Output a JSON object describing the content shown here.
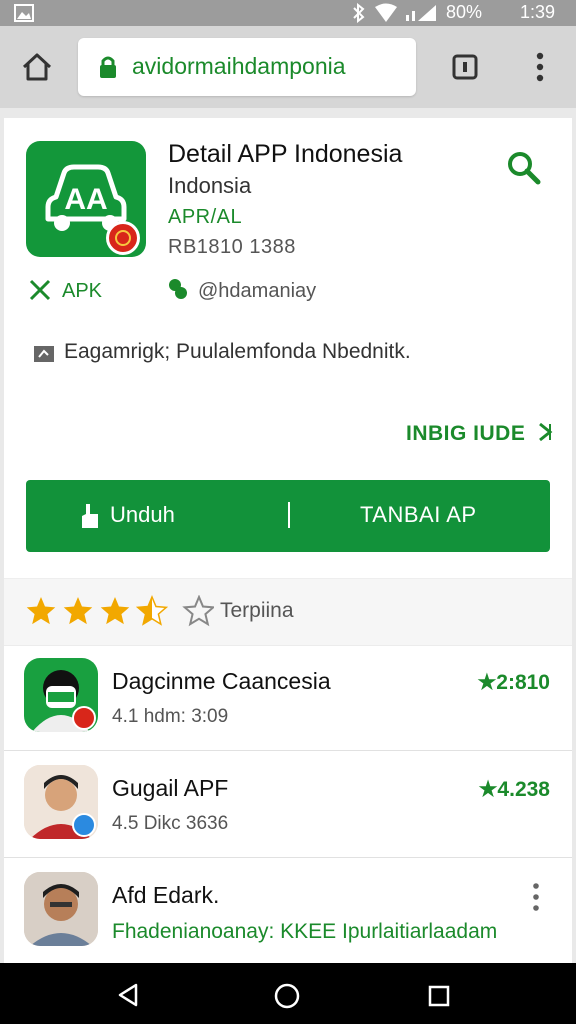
{
  "status_bar": {
    "battery": "80%",
    "time": "1:39"
  },
  "browser": {
    "url": "avidormaihdamponia"
  },
  "app": {
    "title": "Detail APP Indonesia",
    "subtitle": "Indonsia",
    "tag": "APR/AL",
    "version": "RB1810 1388",
    "meta_left": "APK",
    "meta_right": "@hdamaniay",
    "description": "Eagamrigk; Puulalemfonda Nbednitk.",
    "more_link": "INBIG IUDE"
  },
  "cta": {
    "download": "Unduh",
    "install": "TANBAI AP"
  },
  "rating": {
    "value": 3.5,
    "max": 5,
    "label": "Terpiina"
  },
  "list": [
    {
      "title": "Dagcinme Caancesia",
      "sub": "4.1 hdm: 3:09",
      "score": "★2:810",
      "icon": "user-avatar-icon"
    },
    {
      "title": "Gugail APF",
      "sub": "4.5 Dikc 3636",
      "score": "★4.238",
      "icon": "user-avatar-icon"
    },
    {
      "title": "Afd Edark.",
      "sub": "Fhadenianoanay: KKEE Ipurlaitiarlaadam",
      "score": "",
      "icon": "user-avatar-icon"
    }
  ],
  "colors": {
    "accent": "#12923a",
    "badge": "#d8261a"
  }
}
